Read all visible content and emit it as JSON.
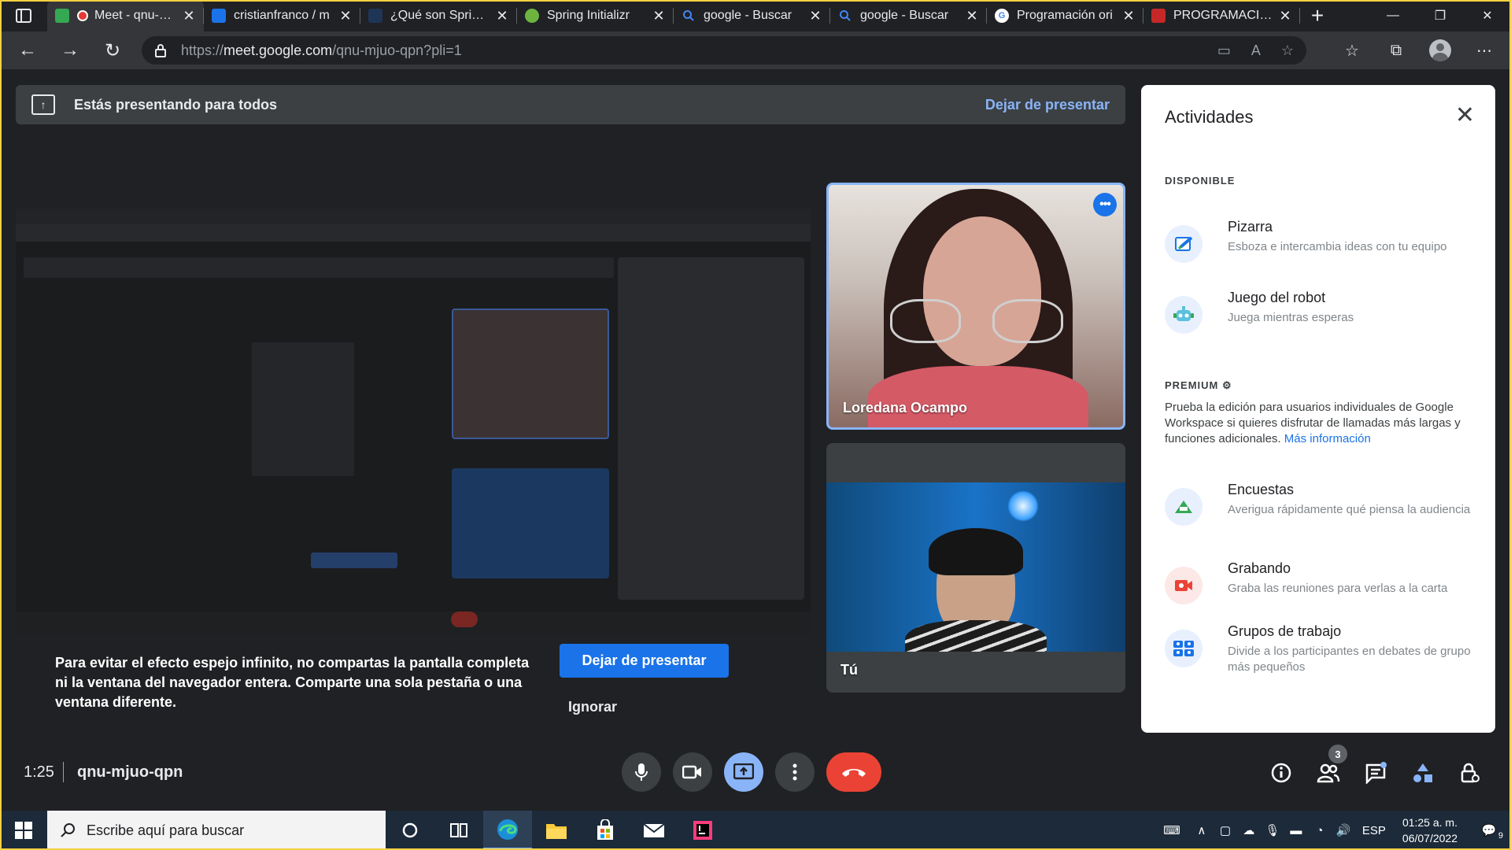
{
  "browser": {
    "tabs": [
      {
        "title": "Meet - qnu-mjuo-qpn",
        "favicon": "meet-icon",
        "color": "#34a853",
        "recording": true,
        "active": true
      },
      {
        "title": "cristianfranco / m",
        "favicon": "bookmark-icon",
        "color": "#1a73e8"
      },
      {
        "title": "¿Qué son Spring f",
        "favicon": "tr-icon",
        "color": "#1f3556"
      },
      {
        "title": "Spring Initializr",
        "favicon": "spring-icon",
        "color": "#6db33f"
      },
      {
        "title": "google - Buscar",
        "favicon": "search-icon",
        "color": "#4285f4"
      },
      {
        "title": "google - Buscar",
        "favicon": "search-icon",
        "color": "#4285f4"
      },
      {
        "title": "Programación ori",
        "favicon": "google-icon",
        "color": "#ffffff"
      },
      {
        "title": "PROGRAMACION",
        "favicon": "slides-icon",
        "color": "#c62828"
      }
    ],
    "url_prefix": "https://",
    "url_host": "meet.google.com",
    "url_path": "/qnu-mjuo-qpn?pli=1"
  },
  "banner": {
    "text": "Estás presentando para todos",
    "stop_label": "Dejar de presentar"
  },
  "warning": {
    "text": "Para evitar el efecto espejo infinito, no compartas la pantalla completa ni la ventana del navegador entera. Comparte una sola pestaña o una ventana diferente.",
    "stop_label": "Dejar de presentar",
    "ignore_label": "Ignorar"
  },
  "participants": [
    {
      "name": "Loredana Ocampo",
      "menu_label": "•••"
    },
    {
      "name": "Tú"
    }
  ],
  "activities": {
    "title": "Actividades",
    "available_label": "DISPONIBLE",
    "available": [
      {
        "title": "Pizarra",
        "description": "Esboza e intercambia ideas con tu equipo",
        "icon": "whiteboard-icon"
      },
      {
        "title": "Juego del robot",
        "description": "Juega mientras esperas",
        "icon": "robot-icon"
      }
    ],
    "premium_label": "PREMIUM",
    "premium_text": "Prueba la edición para usuarios individuales de Google Workspace si quieres disfrutar de llamadas más largas y funciones adicionales.",
    "premium_link": "Más información",
    "premium": [
      {
        "title": "Encuestas",
        "description": "Averigua rápidamente qué piensa la audiencia",
        "icon": "poll-icon"
      },
      {
        "title": "Grabando",
        "description": "Graba las reuniones para verlas a la carta",
        "icon": "record-icon"
      },
      {
        "title": "Grupos de trabajo",
        "description": "Divide a los participantes en debates de grupo más pequeños",
        "icon": "breakout-icon"
      }
    ]
  },
  "call": {
    "time": "1:25",
    "code": "qnu-mjuo-qpn",
    "people_count": "3"
  },
  "taskbar": {
    "search_placeholder": "Escribe aquí para buscar",
    "language": "ESP",
    "time": "01:25 a. m.",
    "date": "06/07/2022",
    "notifications": "9"
  },
  "colors": {
    "accent": "#8ab4f8",
    "primary_button": "#1a73e8",
    "hangup": "#ea4335",
    "frame": "#f4d03f"
  }
}
